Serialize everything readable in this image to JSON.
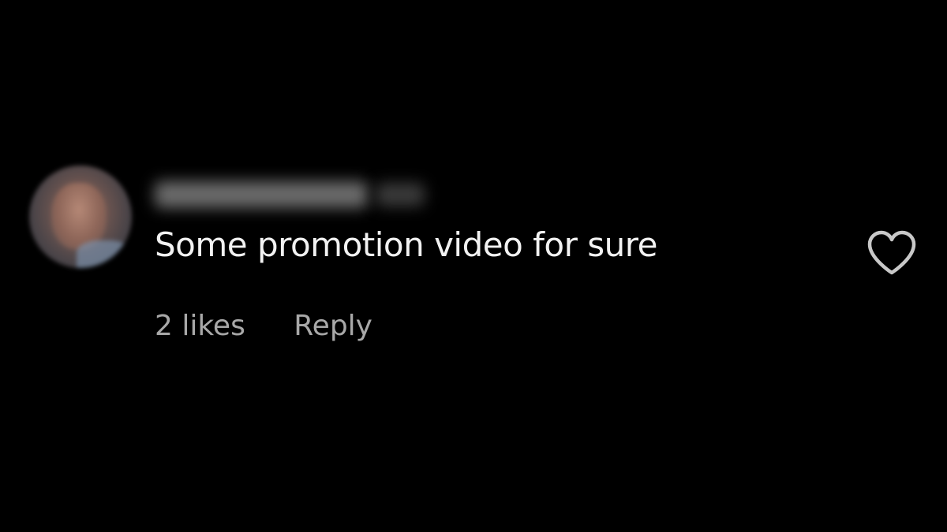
{
  "comment": {
    "text": "Some promotion video for sure",
    "likes_label": "2 likes",
    "reply_label": "Reply"
  },
  "colors": {
    "background": "#000000",
    "comment_text": "#f2f2f2",
    "meta_text": "#a8a8a8",
    "heart_stroke": "#c8c8c8"
  },
  "icons": {
    "like": "heart-outline-icon"
  }
}
